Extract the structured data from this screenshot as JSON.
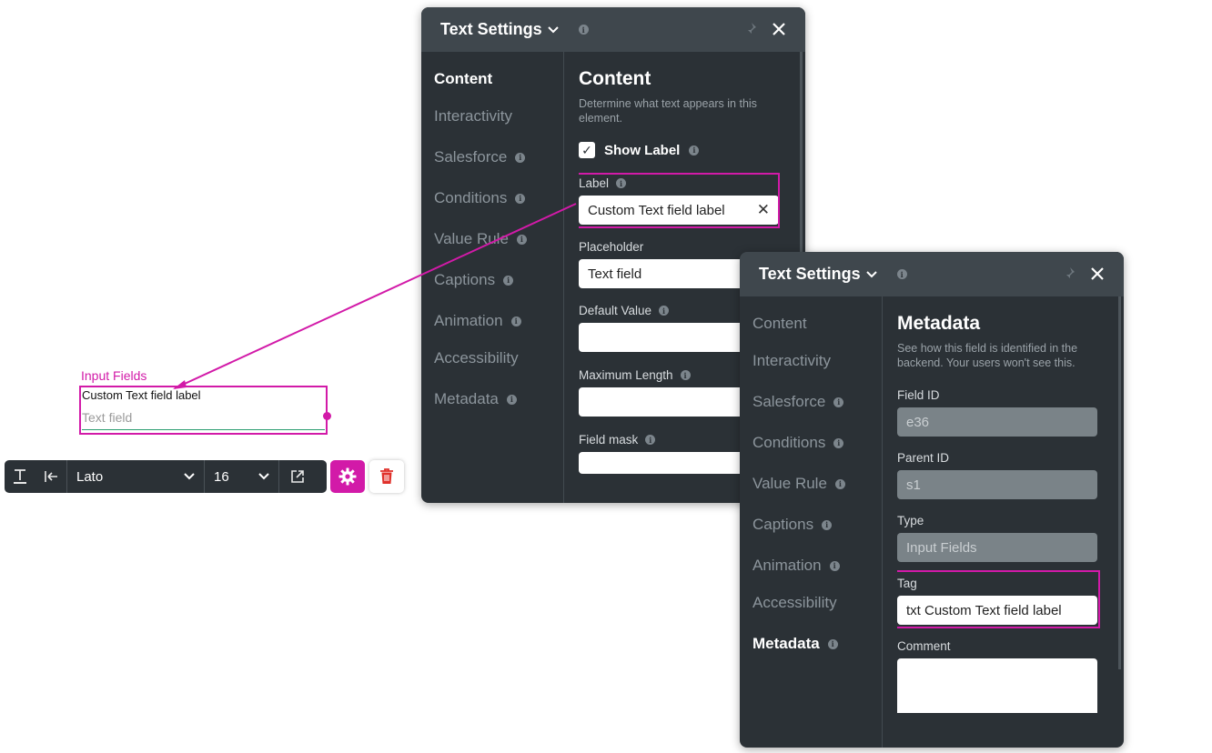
{
  "canvas": {
    "section_label": "Input Fields",
    "field_label": "Custom Text field label",
    "field_placeholder": "Text field"
  },
  "toolbar": {
    "font": "Lato",
    "size": "16",
    "icons": [
      "text-style-icon",
      "align-left-icon",
      "chevron-down-icon",
      "external-link-icon",
      "gear-icon",
      "trash-icon"
    ]
  },
  "panel_content": {
    "title": "Text Settings",
    "nav": [
      "Content",
      "Interactivity",
      "Salesforce",
      "Conditions",
      "Value Rule",
      "Captions",
      "Animation",
      "Accessibility",
      "Metadata"
    ],
    "section_title": "Content",
    "description": "Determine what text appears in this element.",
    "show_label": "Show Label",
    "label_field": "Label",
    "label_value": "Custom Text field label",
    "placeholder_field": "Placeholder",
    "placeholder_value": "Text field",
    "default_value_field": "Default Value",
    "max_length_field": "Maximum Length",
    "field_mask": "Field mask"
  },
  "panel_metadata": {
    "title": "Text Settings",
    "nav": [
      "Content",
      "Interactivity",
      "Salesforce",
      "Conditions",
      "Value Rule",
      "Captions",
      "Animation",
      "Accessibility",
      "Metadata"
    ],
    "section_title": "Metadata",
    "description": "See how this field is identified in the backend. Your users won't see this.",
    "field_id_label": "Field ID",
    "field_id_value": "e36",
    "parent_id_label": "Parent ID",
    "parent_id_value": "s1",
    "type_label": "Type",
    "type_value": "Input Fields",
    "tag_label": "Tag",
    "tag_value": "txt Custom Text field label",
    "comment_label": "Comment"
  },
  "colors": {
    "accent": "#d21aa8",
    "panel_bg": "#2b3136",
    "panel_header": "#3f474d"
  }
}
